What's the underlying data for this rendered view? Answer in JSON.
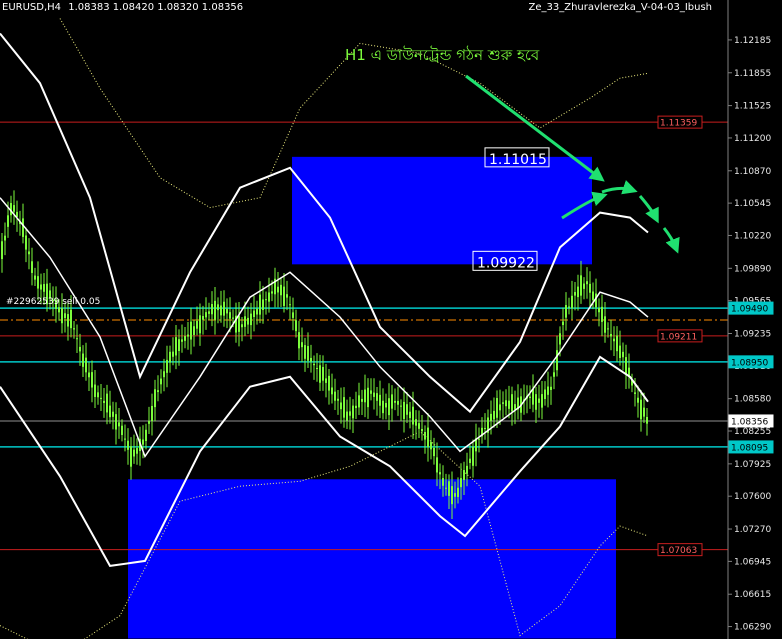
{
  "header": {
    "symbol": "EURUSD,H4",
    "ohlc": "1.08383 1.08420 1.08320 1.08356",
    "indicator": "Ze_33_Zhuravlerezka_V-04-03_Ibush",
    "order_label": "#22962539 sell 0.05"
  },
  "annotation": "H1 এ ডাউনট্রেন্ড গঠন শুরু হবে",
  "colors": {
    "background": "#000000",
    "candle": "#7cfc3c",
    "bands": "#ffffff",
    "zones": "#0000ff",
    "cyan": "#00c8c8",
    "red_line": "#c81e1e",
    "arrows": "#20e070",
    "order_line": "#ff8c00"
  },
  "chart_data": {
    "type": "candlestick",
    "title": "",
    "ylim": [
      1.06165,
      1.12345
    ],
    "y_ticks": [
      "1.12185",
      "1.11855",
      "1.11525",
      "1.11200",
      "1.10870",
      "1.10545",
      "1.10220",
      "1.09890",
      "1.09565",
      "1.09235",
      "1.08910",
      "1.08580",
      "1.08255",
      "1.07925",
      "1.07600",
      "1.07270",
      "1.06945",
      "1.06615",
      "1.06290"
    ],
    "horizontal_levels": [
      {
        "price": 1.11359,
        "label": "1.11359",
        "kind": "resistance-red"
      },
      {
        "price": 1.0949,
        "label": "1.09490",
        "kind": "cyan"
      },
      {
        "price": 1.09211,
        "label": "1.09211",
        "kind": "red"
      },
      {
        "price": 1.0895,
        "label": "1.08950",
        "kind": "cyan"
      },
      {
        "price": 1.08356,
        "label": "1.08356",
        "kind": "current-price"
      },
      {
        "price": 1.08095,
        "label": "1.08095",
        "kind": "cyan"
      },
      {
        "price": 1.07063,
        "label": "1.07063",
        "kind": "support-red"
      },
      {
        "price": 1.0937,
        "label": "",
        "kind": "order-line"
      }
    ],
    "zones": [
      {
        "price_top": 1.1101,
        "price_bottom": 1.0993,
        "label_top": "1.11015",
        "label_bottom": "1.09922"
      },
      {
        "price_top": 1.0777,
        "price_bottom": 1.0617,
        "label_top": "",
        "label_bottom": ""
      }
    ],
    "price_path": [
      [
        0,
        1.0995
      ],
      [
        12,
        1.1055
      ],
      [
        24,
        1.1025
      ],
      [
        36,
        1.0975
      ],
      [
        48,
        1.0965
      ],
      [
        60,
        1.0945
      ],
      [
        72,
        1.0935
      ],
      [
        84,
        1.0895
      ],
      [
        96,
        1.0865
      ],
      [
        108,
        1.085
      ],
      [
        120,
        1.083
      ],
      [
        132,
        1.08
      ],
      [
        144,
        1.0815
      ],
      [
        156,
        1.086
      ],
      [
        168,
        1.0895
      ],
      [
        180,
        1.0915
      ],
      [
        192,
        1.0925
      ],
      [
        204,
        1.094
      ],
      [
        216,
        1.095
      ],
      [
        228,
        1.0945
      ],
      [
        240,
        1.093
      ],
      [
        252,
        1.094
      ],
      [
        264,
        1.0955
      ],
      [
        276,
        1.097
      ],
      [
        288,
        1.096
      ],
      [
        300,
        1.0915
      ],
      [
        312,
        1.0895
      ],
      [
        324,
        1.088
      ],
      [
        336,
        1.086
      ],
      [
        348,
        1.084
      ],
      [
        360,
        1.0855
      ],
      [
        372,
        1.0865
      ],
      [
        384,
        1.085
      ],
      [
        396,
        1.0855
      ],
      [
        408,
        1.0845
      ],
      [
        420,
        1.083
      ],
      [
        432,
        1.081
      ],
      [
        444,
        1.077
      ],
      [
        456,
        1.076
      ],
      [
        468,
        1.079
      ],
      [
        480,
        1.082
      ],
      [
        492,
        1.084
      ],
      [
        504,
        1.0855
      ],
      [
        516,
        1.085
      ],
      [
        528,
        1.086
      ],
      [
        540,
        1.0855
      ],
      [
        552,
        1.087
      ],
      [
        564,
        1.094
      ],
      [
        576,
        1.0965
      ],
      [
        588,
        1.0975
      ],
      [
        600,
        1.0945
      ],
      [
        612,
        1.092
      ],
      [
        624,
        1.09
      ],
      [
        636,
        1.086
      ],
      [
        648,
        1.0835
      ]
    ],
    "bollinger": {
      "upper": [
        [
          0,
          1.1225
        ],
        [
          40,
          1.1175
        ],
        [
          90,
          1.106
        ],
        [
          140,
          1.088
        ],
        [
          190,
          1.0985
        ],
        [
          240,
          1.107
        ],
        [
          290,
          1.109
        ],
        [
          330,
          1.104
        ],
        [
          380,
          1.093
        ],
        [
          430,
          1.088
        ],
        [
          470,
          1.0845
        ],
        [
          520,
          1.0915
        ],
        [
          560,
          1.101
        ],
        [
          600,
          1.1045
        ],
        [
          630,
          1.104
        ],
        [
          648,
          1.1025
        ]
      ],
      "middle": [
        [
          0,
          1.106
        ],
        [
          50,
          1.1
        ],
        [
          100,
          1.092
        ],
        [
          145,
          1.08
        ],
        [
          200,
          1.088
        ],
        [
          250,
          1.096
        ],
        [
          290,
          1.0985
        ],
        [
          340,
          1.094
        ],
        [
          380,
          1.089
        ],
        [
          430,
          1.084
        ],
        [
          460,
          1.0805
        ],
        [
          520,
          1.085
        ],
        [
          560,
          1.0905
        ],
        [
          600,
          1.0965
        ],
        [
          630,
          1.0955
        ],
        [
          648,
          1.094
        ]
      ],
      "lower": [
        [
          0,
          1.087
        ],
        [
          60,
          1.078
        ],
        [
          110,
          1.069
        ],
        [
          145,
          1.0695
        ],
        [
          200,
          1.0805
        ],
        [
          250,
          1.087
        ],
        [
          290,
          1.088
        ],
        [
          340,
          1.082
        ],
        [
          390,
          1.079
        ],
        [
          440,
          1.074
        ],
        [
          465,
          1.072
        ],
        [
          520,
          1.0785
        ],
        [
          560,
          1.083
        ],
        [
          600,
          1.09
        ],
        [
          630,
          1.088
        ],
        [
          648,
          1.0855
        ]
      ]
    },
    "outer_envelope": {
      "upper": [
        [
          60,
          1.124
        ],
        [
          100,
          1.117
        ],
        [
          160,
          1.108
        ],
        [
          210,
          1.105
        ],
        [
          260,
          1.106
        ],
        [
          300,
          1.115
        ],
        [
          360,
          1.1215
        ],
        [
          420,
          1.1205
        ],
        [
          480,
          1.1175
        ],
        [
          540,
          1.113
        ],
        [
          590,
          1.116
        ],
        [
          620,
          1.118
        ],
        [
          648,
          1.1185
        ]
      ],
      "lower": [
        [
          0,
          1.063
        ],
        [
          60,
          1.06
        ],
        [
          120,
          1.064
        ],
        [
          180,
          1.0755
        ],
        [
          240,
          1.077
        ],
        [
          300,
          1.0775
        ],
        [
          350,
          1.079
        ],
        [
          420,
          1.0825
        ],
        [
          480,
          1.077
        ],
        [
          520,
          1.062
        ],
        [
          560,
          1.065
        ],
        [
          600,
          1.071
        ],
        [
          620,
          1.073
        ],
        [
          648,
          1.072
        ]
      ]
    }
  }
}
